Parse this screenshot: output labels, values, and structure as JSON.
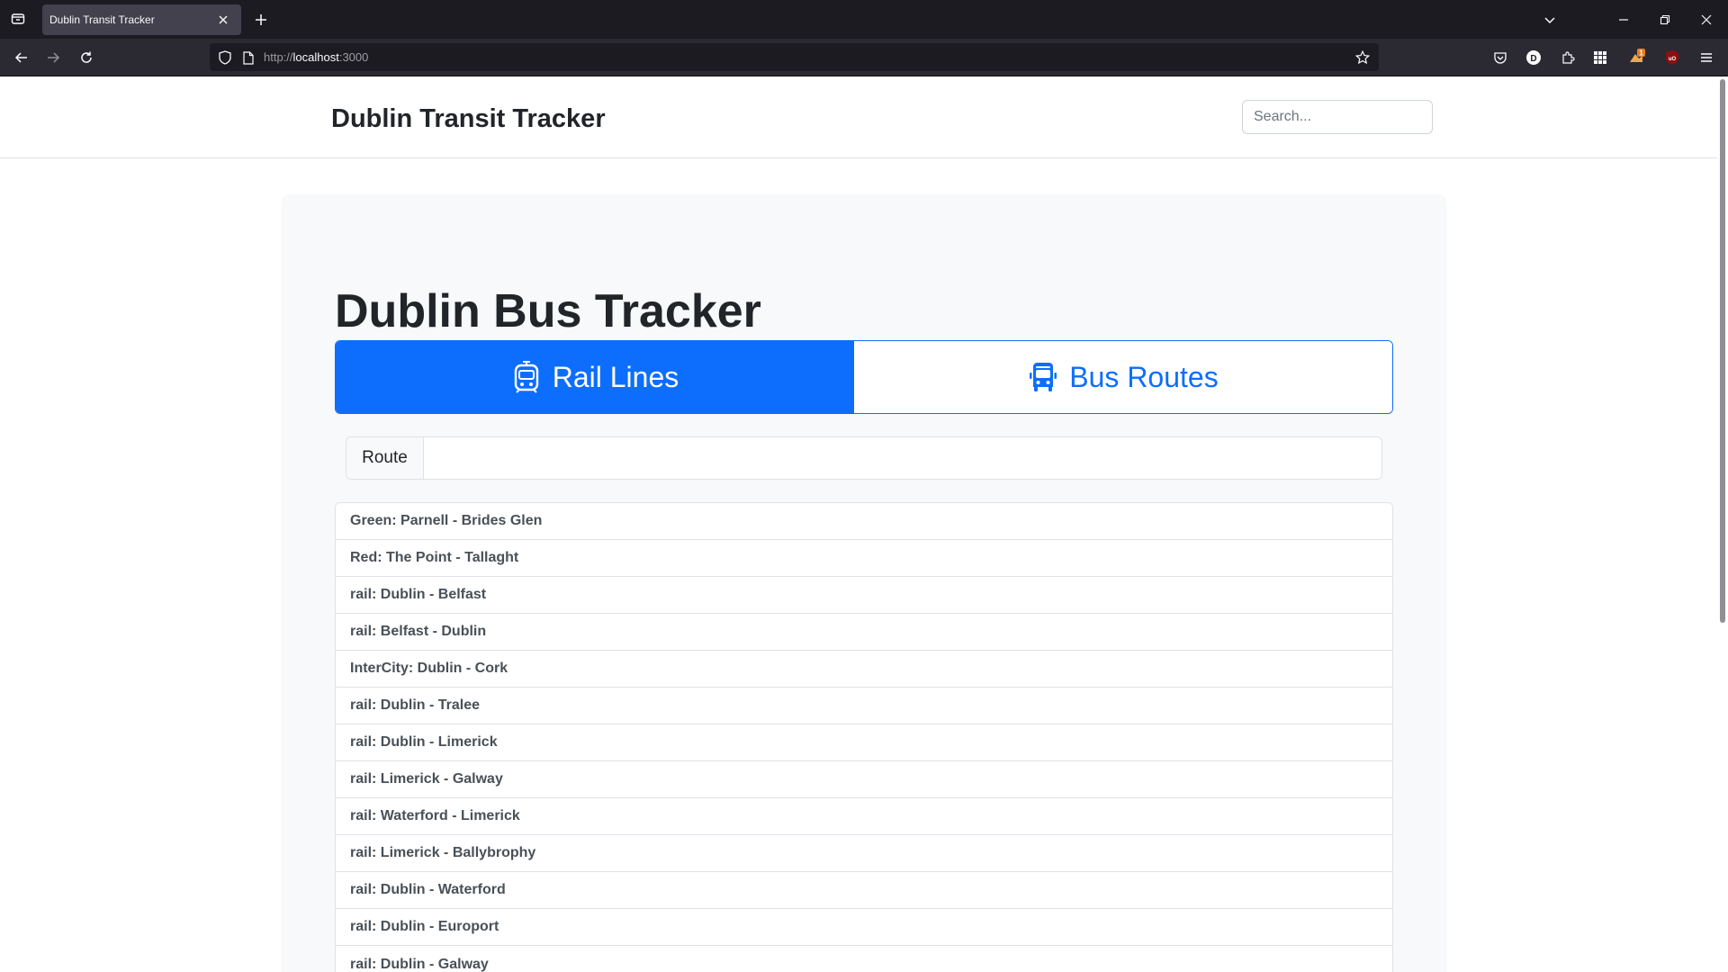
{
  "browser": {
    "tab_title": "Dublin Transit Tracker",
    "url_scheme": "http://",
    "url_host": "localhost",
    "url_port": ":3000",
    "extension_badge": "1",
    "profile_letter": "D"
  },
  "header": {
    "brand": "Dublin Transit Tracker",
    "search_placeholder": "Search..."
  },
  "main": {
    "title": "Dublin Bus Tracker",
    "tabs": [
      {
        "label": "Rail Lines",
        "icon": "train-icon",
        "active": true
      },
      {
        "label": "Bus Routes",
        "icon": "bus-icon",
        "active": false
      }
    ],
    "route_label": "Route",
    "route_value": "",
    "routes": [
      "Green: Parnell - Brides Glen",
      "Red: The Point - Tallaght",
      "rail: Dublin - Belfast",
      "rail: Belfast - Dublin",
      "InterCity: Dublin - Cork",
      "rail: Dublin - Tralee",
      "rail: Dublin - Limerick",
      "rail: Limerick - Galway",
      "rail: Waterford - Limerick",
      "rail: Limerick - Ballybrophy",
      "rail: Dublin - Waterford",
      "rail: Dublin - Europort",
      "rail: Dublin - Galway"
    ]
  },
  "colors": {
    "primary": "#0d6efd",
    "panel_bg": "#f8f9fa",
    "chrome_dark": "#1c1b22"
  }
}
